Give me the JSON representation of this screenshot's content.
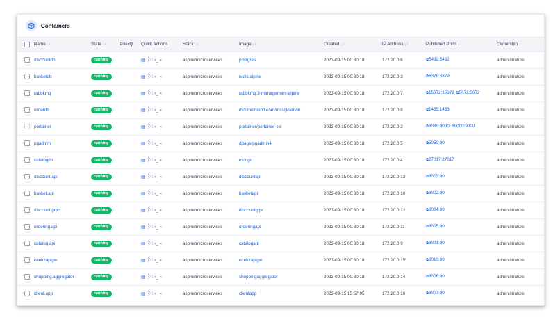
{
  "panel": {
    "title": "Containers",
    "icon": "box-icon"
  },
  "columns": {
    "name": "Name",
    "state": "State",
    "filter": "Filter",
    "quick_actions": "Quick Actions",
    "stack": "Stack",
    "image": "Image",
    "created": "Created",
    "ip": "IP Address",
    "ports": "Published Ports",
    "ownership": "Ownership"
  },
  "sort_glyph": "↓↑",
  "quick_action_icons": [
    "logs-icon",
    "inspect-icon",
    "stats-icon",
    "console-icon",
    "attach-icon"
  ],
  "quick_action_glyphs": [
    "▤",
    "ⓘ",
    "⫶",
    "›_",
    "⌁"
  ],
  "port_link_glyph": "⧉",
  "status_color": "#12b76a",
  "accent_color": "#175cd3",
  "rows": [
    {
      "name": "discountdb",
      "state": "running",
      "stack": "aspnetmicroservices",
      "image": "postgres",
      "created": "2023-09-15 00:30:18",
      "ip": "172.20.0.6",
      "ports": [
        "5432:5432"
      ],
      "ownership": "administrators",
      "selectable": true
    },
    {
      "name": "basketdb",
      "state": "running",
      "stack": "aspnetmicroservices",
      "image": "redis:alpine",
      "created": "2023-09-15 00:30:18",
      "ip": "172.20.0.3",
      "ports": [
        "6379:6379"
      ],
      "ownership": "administrators",
      "selectable": true
    },
    {
      "name": "rabbitmq",
      "state": "running",
      "stack": "aspnetmicroservices",
      "image": "rabbitmq:3-management-alpine",
      "created": "2023-09-15 00:30:18",
      "ip": "172.20.0.7",
      "ports": [
        "15672:15672",
        "5672:5672"
      ],
      "ownership": "administrators",
      "selectable": true
    },
    {
      "name": "orderdb",
      "state": "running",
      "stack": "aspnetmicroservices",
      "image": "mcr.microsoft.com/mssql/server",
      "created": "2023-09-15 00:30:18",
      "ip": "172.20.0.8",
      "ports": [
        "1433:1433"
      ],
      "ownership": "administrators",
      "selectable": true
    },
    {
      "name": "portainer",
      "state": "running",
      "stack": "aspnetmicroservices",
      "image": "portainer/portainer-ce",
      "created": "2023-09-15 00:30:18",
      "ip": "172.20.0.2",
      "ports": [
        "8080:8000",
        "9000:9000"
      ],
      "ownership": "administrators",
      "selectable": false
    },
    {
      "name": "pgadmin",
      "state": "running",
      "stack": "aspnetmicroservices",
      "image": "dpage/pgadmin4",
      "created": "2023-09-15 00:30:18",
      "ip": "172.20.0.5",
      "ports": [
        "5050:80"
      ],
      "ownership": "administrators",
      "selectable": true
    },
    {
      "name": "catalogdb",
      "state": "running",
      "stack": "aspnetmicroservices",
      "image": "mongo",
      "created": "2023-09-15 00:30:18",
      "ip": "172.20.0.4",
      "ports": [
        "27017:27017"
      ],
      "ownership": "administrators",
      "selectable": true
    },
    {
      "name": "discount.api",
      "state": "running",
      "stack": "aspnetmicroservices",
      "image": "discountapi",
      "created": "2023-09-15 00:30:18",
      "ip": "172.20.0.13",
      "ports": [
        "8003:80"
      ],
      "ownership": "administrators",
      "selectable": true
    },
    {
      "name": "basket.api",
      "state": "running",
      "stack": "aspnetmicroservices",
      "image": "basketapi",
      "created": "2023-09-15 00:30:18",
      "ip": "172.20.0.10",
      "ports": [
        "8002:80"
      ],
      "ownership": "administrators",
      "selectable": true
    },
    {
      "name": "discount.grpc",
      "state": "running",
      "stack": "aspnetmicroservices",
      "image": "discountgrpc",
      "created": "2023-09-15 00:30:18",
      "ip": "172.20.0.12",
      "ports": [
        "8004:80"
      ],
      "ownership": "administrators",
      "selectable": true
    },
    {
      "name": "ordering.api",
      "state": "running",
      "stack": "aspnetmicroservices",
      "image": "orderingapi",
      "created": "2023-09-15 00:30:18",
      "ip": "172.20.0.11",
      "ports": [
        "8005:80"
      ],
      "ownership": "administrators",
      "selectable": true
    },
    {
      "name": "catalog.api",
      "state": "running",
      "stack": "aspnetmicroservices",
      "image": "catalogapi",
      "created": "2023-09-15 00:30:18",
      "ip": "172.20.0.9",
      "ports": [
        "8001:80"
      ],
      "ownership": "administrators",
      "selectable": true
    },
    {
      "name": "ocelotapigw",
      "state": "running",
      "stack": "aspnetmicroservices",
      "image": "ocelotapigw",
      "created": "2023-09-15 00:30:18",
      "ip": "172.20.0.15",
      "ports": [
        "8010:80"
      ],
      "ownership": "administrators",
      "selectable": true
    },
    {
      "name": "shopping.aggregator",
      "state": "running",
      "stack": "aspnetmicroservices",
      "image": "shoppingaggregator",
      "created": "2023-09-15 00:30:18",
      "ip": "172.20.0.14",
      "ports": [
        "8006:80"
      ],
      "ownership": "administrators",
      "selectable": true
    },
    {
      "name": "client.app",
      "state": "running",
      "stack": "aspnetmicroservices",
      "image": "clientapp",
      "created": "2023-09-15 15:57:05",
      "ip": "172.20.0.16",
      "ports": [
        "8007:80"
      ],
      "ownership": "administrators",
      "selectable": true
    }
  ]
}
